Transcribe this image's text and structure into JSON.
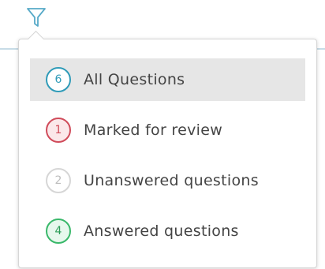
{
  "filter": {
    "icon": "funnel-icon",
    "color": "#58aac8"
  },
  "menu": {
    "items": [
      {
        "badge": "6",
        "label": "All Questions",
        "badge_border": "#2f9bb8",
        "badge_bg": "#ffffff",
        "badge_color": "#2f9bb8",
        "active": true
      },
      {
        "badge": "1",
        "label": "Marked for review",
        "badge_border": "#d04b5a",
        "badge_bg": "#fbe8ea",
        "badge_color": "#d04b5a",
        "active": false
      },
      {
        "badge": "2",
        "label": "Unanswered questions",
        "badge_border": "#d6d6d6",
        "badge_bg": "#ffffff",
        "badge_color": "#bdbdbd",
        "active": false
      },
      {
        "badge": "4",
        "label": "Answered questions",
        "badge_border": "#39b86a",
        "badge_bg": "#e7f8ed",
        "badge_color": "#2c9c57",
        "active": false
      }
    ]
  }
}
